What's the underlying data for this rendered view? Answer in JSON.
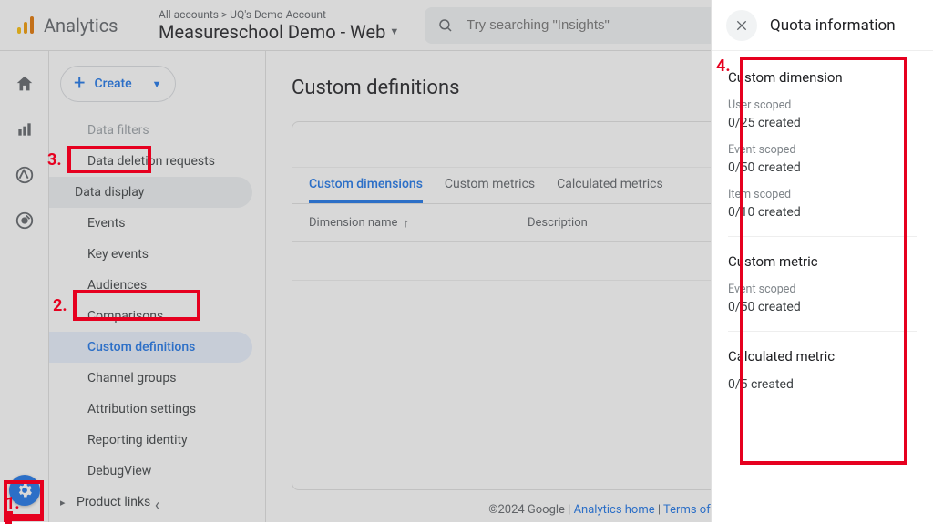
{
  "header": {
    "product": "Analytics",
    "breadcrumb_top": "All accounts > UQ's Demo Account",
    "breadcrumb_main": "Measureschool Demo - Web",
    "search_placeholder": "Try searching \"Insights\""
  },
  "create_button": "Create",
  "sidebar": {
    "items": [
      {
        "label": "Data filters"
      },
      {
        "label": "Data deletion requests"
      },
      {
        "label": "Data display",
        "section": true
      },
      {
        "label": "Events"
      },
      {
        "label": "Key events"
      },
      {
        "label": "Audiences"
      },
      {
        "label": "Comparisons"
      },
      {
        "label": "Custom definitions",
        "active": true
      },
      {
        "label": "Channel groups"
      },
      {
        "label": "Attribution settings"
      },
      {
        "label": "Reporting identity"
      },
      {
        "label": "DebugView"
      },
      {
        "label": "Product links",
        "expand": true
      }
    ]
  },
  "main": {
    "title": "Custom definitions",
    "tabs": [
      "Custom dimensions",
      "Custom metrics",
      "Calculated metrics"
    ],
    "columns": {
      "name": "Dimension name",
      "desc": "Description"
    }
  },
  "footer": {
    "copyright": "©2024 Google",
    "link1": "Analytics home",
    "link2": "Terms of"
  },
  "quota": {
    "title": "Quota information",
    "sections": [
      {
        "heading": "Custom dimension",
        "rows": [
          {
            "label": "User scoped",
            "value": "0/25 created"
          },
          {
            "label": "Event scoped",
            "value": "0/50 created"
          },
          {
            "label": "Item scoped",
            "value": "0/10 created"
          }
        ]
      },
      {
        "heading": "Custom metric",
        "rows": [
          {
            "label": "Event scoped",
            "value": "0/50 created"
          }
        ]
      },
      {
        "heading": "Calculated metric",
        "rows": [
          {
            "label": "",
            "value": "0/5 created"
          }
        ]
      }
    ]
  },
  "annotations": {
    "n1": "1.",
    "n2": "2.",
    "n3": "3.",
    "n4": "4."
  }
}
